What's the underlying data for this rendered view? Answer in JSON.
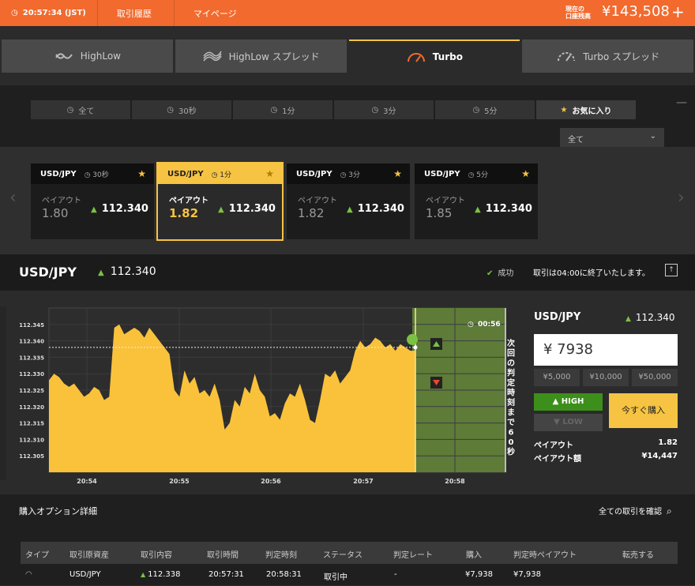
{
  "topbar": {
    "time": "20:57:34 (JST)",
    "history": "取引履歴",
    "mypage": "マイページ",
    "balance_label_1": "現在の",
    "balance_label_2": "口座残高",
    "balance": "¥143,508",
    "plus": "+"
  },
  "tabs": [
    {
      "label": "HighLow",
      "icon": "highlow-icon"
    },
    {
      "label": "HighLow スプレッド",
      "icon": "spread-icon"
    },
    {
      "label": "Turbo",
      "icon": "turbo-gauge-icon"
    },
    {
      "label": "Turbo スプレッド",
      "icon": "turbo-spread-icon"
    }
  ],
  "filters": [
    "全て",
    "30秒",
    "1分",
    "3分",
    "5分",
    "お気に入り"
  ],
  "dropdown": {
    "value": "全て"
  },
  "cards": [
    {
      "pair": "USD/JPY",
      "period": "30秒",
      "payout_label": "ペイアウト",
      "payout": "1.80",
      "rate": "112.340"
    },
    {
      "pair": "USD/JPY",
      "period": "1分",
      "payout_label": "ペイアウト",
      "payout": "1.82",
      "rate": "112.340"
    },
    {
      "pair": "USD/JPY",
      "period": "3分",
      "payout_label": "ペイアウト",
      "payout": "1.82",
      "rate": "112.340"
    },
    {
      "pair": "USD/JPY",
      "period": "5分",
      "payout_label": "ペイアウト",
      "payout": "1.85",
      "rate": "112.340"
    }
  ],
  "pairbar": {
    "pair": "USD/JPY",
    "rate": "112.340",
    "status": "成功",
    "message": "取引は04:00に終了いたします。"
  },
  "chart_data": {
    "type": "area",
    "y_ticks": [
      "112.345",
      "112.340",
      "112.335",
      "112.330",
      "112.325",
      "112.320",
      "112.315",
      "112.310",
      "112.305"
    ],
    "x_ticks": [
      "20:54",
      "20:55",
      "20:56",
      "20:57",
      "20:58"
    ],
    "ylim": [
      112.3,
      112.35
    ],
    "countdown": "00:56",
    "vertical_text": "次回の判定時刻まで60秒",
    "current_rate": 112.338,
    "grid": true,
    "series": [
      {
        "values": [
          112.328,
          112.33,
          112.329,
          112.327,
          112.326,
          112.327,
          112.325,
          112.323,
          112.324,
          112.326,
          112.325,
          112.322,
          112.323,
          112.344,
          112.345,
          112.342,
          112.343,
          112.344,
          112.343,
          112.341,
          112.344,
          112.342,
          112.34,
          112.338,
          112.336,
          112.325,
          112.323,
          112.331,
          112.327,
          112.329,
          112.324,
          112.325,
          112.323,
          112.327,
          112.322,
          112.313,
          112.315,
          112.322,
          112.32,
          112.326,
          112.324,
          112.33,
          112.325,
          112.323,
          112.317,
          112.318,
          112.316,
          112.321,
          112.324,
          112.323,
          112.327,
          112.322,
          112.316,
          112.315,
          112.322,
          112.33,
          112.329,
          112.331,
          112.327,
          112.329,
          112.331,
          112.337,
          112.34,
          112.338,
          112.339,
          112.341,
          112.34,
          112.338,
          112.339,
          112.337,
          112.339,
          112.338,
          112.337,
          112.337
        ]
      }
    ]
  },
  "side": {
    "pair": "USD/JPY",
    "rate": "112.340",
    "amount": "¥ 7938",
    "quick": [
      "¥5,000",
      "¥10,000",
      "¥50,000"
    ],
    "high": "HIGH",
    "low": "LOW",
    "buy": "今すぐ購入",
    "payout_label": "ペイアウト",
    "payout": "1.82",
    "payout_amount_label": "ペイアウト額",
    "payout_amount": "¥14,447"
  },
  "bottom": {
    "title": "購入オプション詳細",
    "all_link": "全ての取引を確認",
    "headers": [
      "タイプ",
      "取引原資産",
      "取引内容",
      "取引時間",
      "判定時刻",
      "ステータス",
      "判定レート",
      "購入",
      "判定時ペイアウト",
      "転売する"
    ],
    "row": {
      "asset": "USD/JPY",
      "content": "112.338",
      "time": "20:57:31",
      "judge": "20:58:31",
      "status": "取引中",
      "judge_rate": "-",
      "purchase": "¥7,938",
      "payout": "¥7,938"
    }
  },
  "colors": {
    "accent": "#f26a2e",
    "yellow": "#f6c343",
    "green": "#7ac243",
    "zone": "#5e7b38"
  }
}
